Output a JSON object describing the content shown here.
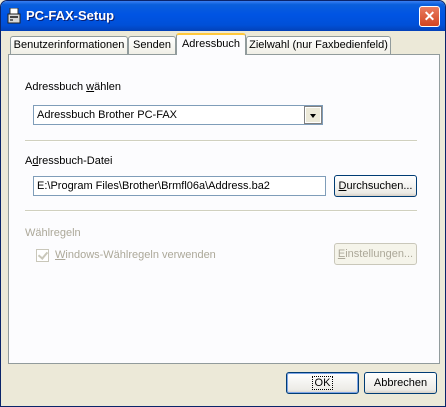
{
  "window": {
    "title": "PC-FAX-Setup",
    "close_symbol": "✕"
  },
  "tabs": [
    {
      "label": "Benutzerinformationen"
    },
    {
      "label": "Senden"
    },
    {
      "label": "Adressbuch"
    },
    {
      "label": "Zielwahl (nur Faxbedienfeld)"
    }
  ],
  "address_book_select": {
    "label_pre": "Adressbuch ",
    "label_ul": "w",
    "label_post": "ählen",
    "value": "Adressbuch Brother PC-FAX"
  },
  "address_file": {
    "label_pre": "A",
    "label_ul": "d",
    "label_post": "ressbuch-Datei",
    "value": "E:\\Program Files\\Brother\\Brmfl06a\\Address.ba2",
    "browse_ul": "D",
    "browse_post": "urchsuchen..."
  },
  "dial_rules": {
    "group_label": "Wählregeln",
    "checkbox_ul": "W",
    "checkbox_post": "indows-Wählregeln verwenden",
    "checked": true,
    "settings_ul": "E",
    "settings_post": "instellungen..."
  },
  "footer": {
    "ok_label": "OK",
    "cancel_label": "Abbrechen"
  }
}
